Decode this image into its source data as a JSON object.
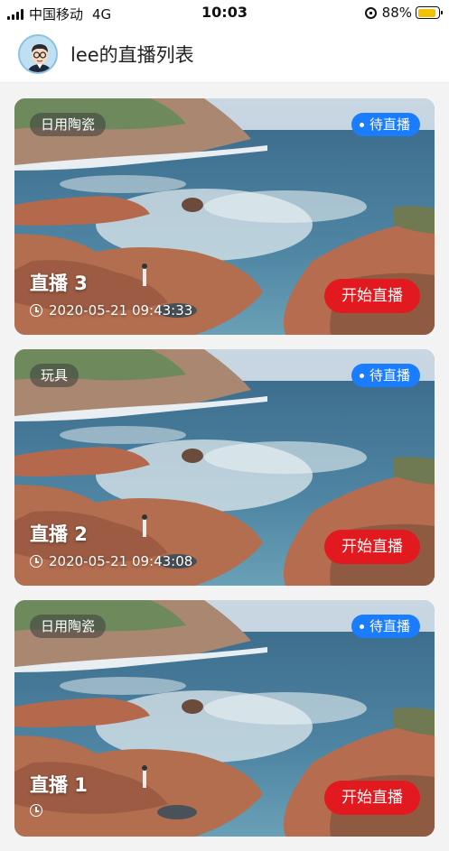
{
  "status_bar": {
    "carrier": "中国移动",
    "network": "4G",
    "time": "10:03",
    "battery": "88%",
    "battery_level": 0.88,
    "battery_color": "#f2c200"
  },
  "header": {
    "title": "lee的直播列表",
    "avatar_icon": "avatar-cartoon-man"
  },
  "cards": [
    {
      "tag": "日用陶瓷",
      "status": "待直播",
      "title": "直播 3",
      "time": "2020-05-21 09:43:33",
      "button": "开始直播"
    },
    {
      "tag": "玩具",
      "status": "待直播",
      "title": "直播 2",
      "time": "2020-05-21 09:43:08",
      "button": "开始直播"
    },
    {
      "tag": "日用陶瓷",
      "status": "待直播",
      "title": "直播 1",
      "time": "",
      "button": "开始直播"
    }
  ],
  "colors": {
    "status_badge": "#1a7dff",
    "start_button": "#e21a1f"
  }
}
